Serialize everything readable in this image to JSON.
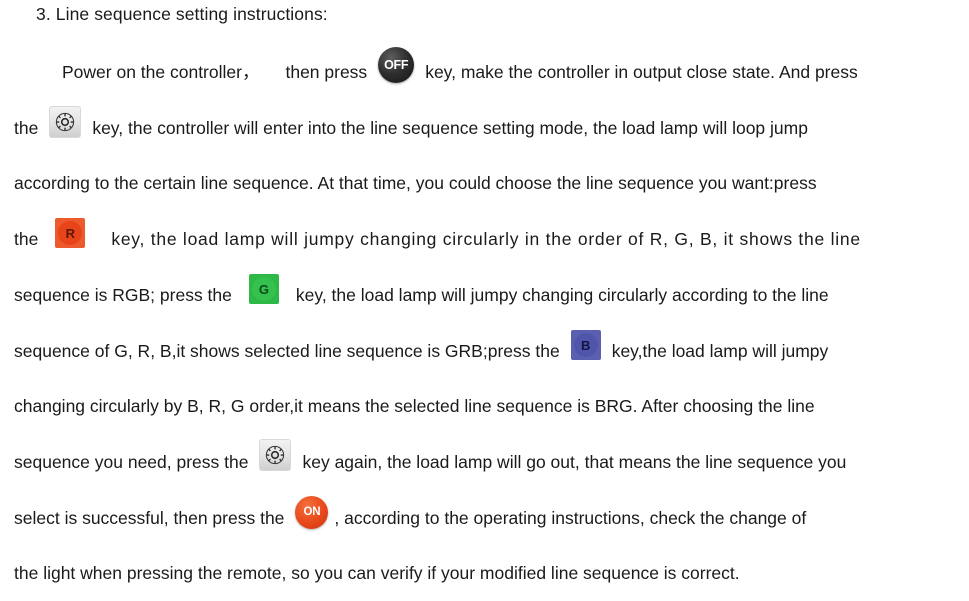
{
  "document": {
    "heading": "3. Line sequence setting instructions:",
    "lines": [
      {
        "id": "line-1",
        "segments": [
          {
            "type": "text",
            "value": "Power on the controller，"
          },
          {
            "type": "text",
            "value": "then press"
          },
          {
            "type": "key",
            "key": "off"
          },
          {
            "type": "text",
            "value": "key, make the controller in output close state. And press"
          }
        ]
      },
      {
        "id": "line-2",
        "segments": [
          {
            "type": "text",
            "value": "the"
          },
          {
            "type": "key",
            "key": "gear"
          },
          {
            "type": "text",
            "value": "key, the controller will enter into the line sequence setting mode, the load lamp will loop jump"
          }
        ]
      },
      {
        "id": "line-3",
        "segments": [
          {
            "type": "text",
            "value": "according to the certain line sequence. At that time, you could choose the line sequence you want:press"
          }
        ]
      },
      {
        "id": "line-4",
        "segments": [
          {
            "type": "text",
            "value": "the"
          },
          {
            "type": "key",
            "key": "r"
          },
          {
            "type": "text",
            "value": "key, the load lamp will jumpy changing circularly in the order of R, G, B, it shows the line"
          }
        ]
      },
      {
        "id": "line-5",
        "segments": [
          {
            "type": "text",
            "value": "sequence is RGB; press the"
          },
          {
            "type": "key",
            "key": "g"
          },
          {
            "type": "text",
            "value": "key, the load lamp will jumpy changing circularly according to the line"
          }
        ]
      },
      {
        "id": "line-6",
        "segments": [
          {
            "type": "text",
            "value": "sequence of G, R, B,it shows selected line sequence is GRB;press the"
          },
          {
            "type": "key",
            "key": "b"
          },
          {
            "type": "text",
            "value": "key,the load lamp will jumpy"
          }
        ]
      },
      {
        "id": "line-7",
        "segments": [
          {
            "type": "text",
            "value": "changing circularly by B, R, G order,it means the selected line sequence is BRG. After choosing the line"
          }
        ]
      },
      {
        "id": "line-8",
        "segments": [
          {
            "type": "text",
            "value": "sequence you need, press the"
          },
          {
            "type": "key",
            "key": "gear"
          },
          {
            "type": "text",
            "value": "key again, the load lamp will go out, that means the line sequence you"
          }
        ]
      },
      {
        "id": "line-9",
        "segments": [
          {
            "type": "text",
            "value": "select is successful, then press the"
          },
          {
            "type": "key",
            "key": "on"
          },
          {
            "type": "text",
            "value": ", according to the operating instructions, check the change of"
          }
        ]
      },
      {
        "id": "line-10",
        "segments": [
          {
            "type": "text",
            "value": "the light when pressing the remote, so you can verify if your modified line sequence is correct."
          }
        ]
      }
    ]
  },
  "text": {
    "heading": "3. Line sequence setting instructions:",
    "l1a": "Power on the controller，",
    "l1b": "then press",
    "l1c": "key, make the controller in output close state. And press",
    "l2a": "the",
    "l2b": "key, the controller will enter into the line sequence setting mode, the load lamp will loop jump",
    "l3": "according to the certain line sequence. At that time, you could choose the line sequence you want:press",
    "l4a": "the",
    "l4b": "key, the load lamp will jumpy changing circularly in the order of R, G, B, it shows the line",
    "l5a": "sequence is RGB; press the",
    "l5b": "key, the load lamp will jumpy changing circularly according to the line",
    "l6a": "sequence of G, R, B,it shows selected line sequence is GRB;press the",
    "l6b": "key,the load lamp will jumpy",
    "l7": "changing circularly by B, R, G order,it means the selected line sequence is BRG. After choosing the line",
    "l8a": "sequence you need, press the",
    "l8b": "key again, the load lamp will go out, that means the line sequence you",
    "l9a": "select is successful, then press the",
    "l9b": ", according to the operating instructions, check the change of",
    "l10": "the light when pressing the remote, so you can verify if your modified line sequence is correct."
  },
  "keys": {
    "off": {
      "label": "OFF",
      "name": "off-key-icon",
      "color": "#212121"
    },
    "on": {
      "label": "ON",
      "name": "on-key-icon",
      "color": "#e8481c"
    },
    "r": {
      "label": "R",
      "name": "red-key-icon",
      "color": "#ed5a2d"
    },
    "g": {
      "label": "G",
      "name": "green-key-icon",
      "color": "#2eb847"
    },
    "b": {
      "label": "B",
      "name": "blue-key-icon",
      "color": "#5a5fb0"
    },
    "gear": {
      "label": "",
      "name": "gear-key-icon",
      "color": "#e2e2e2"
    }
  },
  "colors": {
    "page_background": "#ffffff",
    "text": "#1a1a1a",
    "red": "#ed5a2d",
    "green": "#2eb847",
    "blue": "#5a5fb0",
    "orange": "#e8481c",
    "dark": "#212121"
  }
}
